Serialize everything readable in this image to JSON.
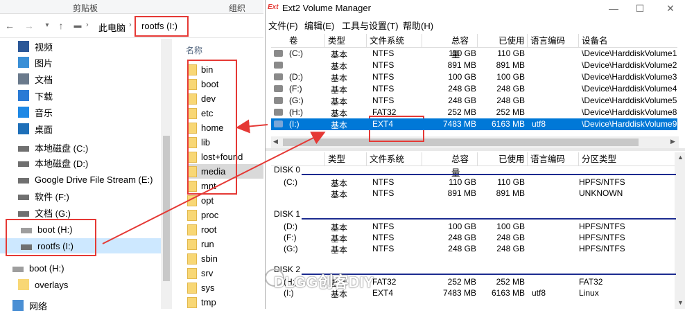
{
  "explorer": {
    "ribbon": [
      "剪贴板",
      "组织"
    ],
    "breadcrumb": [
      "此电脑",
      "rootfs (I:)"
    ],
    "nav_items": [
      {
        "label": "视频",
        "icon": "video-icon"
      },
      {
        "label": "图片",
        "icon": "picture-icon"
      },
      {
        "label": "文档",
        "icon": "document-icon"
      },
      {
        "label": "下载",
        "icon": "download-icon"
      },
      {
        "label": "音乐",
        "icon": "music-icon"
      },
      {
        "label": "桌面",
        "icon": "desktop-icon"
      },
      {
        "label": "本地磁盘 (C:)",
        "icon": "drive-icon"
      },
      {
        "label": "本地磁盘 (D:)",
        "icon": "drive-icon"
      },
      {
        "label": "Google Drive File Stream (E:)",
        "icon": "drive-icon"
      },
      {
        "label": "软件 (F:)",
        "icon": "drive-icon"
      },
      {
        "label": "文档 (G:)",
        "icon": "drive-icon"
      },
      {
        "label": "boot (H:)",
        "icon": "usb-drive-icon"
      },
      {
        "label": "rootfs (I:)",
        "icon": "drive-icon"
      },
      {
        "label": "boot (H:)",
        "icon": "usb-drive-icon"
      },
      {
        "label": "overlays",
        "icon": "folder-icon"
      },
      {
        "label": "网络",
        "icon": "network-icon"
      }
    ],
    "files_header": "名称",
    "files": [
      "bin",
      "boot",
      "dev",
      "etc",
      "home",
      "lib",
      "lost+found",
      "media",
      "mnt",
      "opt",
      "proc",
      "root",
      "run",
      "sbin",
      "srv",
      "sys",
      "tmp"
    ]
  },
  "ext2": {
    "title": "Ext2 Volume Manager",
    "app_icon_text": "Ext",
    "menus": [
      "文件(F)",
      "编辑(E)",
      "工具与设置(T)",
      "帮助(H)"
    ],
    "volume_headers": [
      "卷",
      "类型",
      "文件系统",
      "总容量",
      "已使用",
      "语言编码",
      "设备名"
    ],
    "volumes": [
      {
        "vol": "(C:)",
        "type": "基本",
        "fs": "NTFS",
        "total": "110 GB",
        "used": "110 GB",
        "enc": "",
        "device": "\\Device\\HarddiskVolume1"
      },
      {
        "vol": "",
        "type": "基本",
        "fs": "NTFS",
        "total": "891 MB",
        "used": "891 MB",
        "enc": "",
        "device": "\\Device\\HarddiskVolume2"
      },
      {
        "vol": "(D:)",
        "type": "基本",
        "fs": "NTFS",
        "total": "100 GB",
        "used": "100 GB",
        "enc": "",
        "device": "\\Device\\HarddiskVolume3"
      },
      {
        "vol": "(F:)",
        "type": "基本",
        "fs": "NTFS",
        "total": "248 GB",
        "used": "248 GB",
        "enc": "",
        "device": "\\Device\\HarddiskVolume4"
      },
      {
        "vol": "(G:)",
        "type": "基本",
        "fs": "NTFS",
        "total": "248 GB",
        "used": "248 GB",
        "enc": "",
        "device": "\\Device\\HarddiskVolume5"
      },
      {
        "vol": "(H:)",
        "type": "基本",
        "fs": "FAT32",
        "total": "252 MB",
        "used": "252 MB",
        "enc": "",
        "device": "\\Device\\HarddiskVolume8"
      },
      {
        "vol": "(I:)",
        "type": "基本",
        "fs": "EXT4",
        "total": "7483 MB",
        "used": "6163 MB",
        "enc": "utf8",
        "device": "\\Device\\HarddiskVolume9"
      }
    ],
    "disk_headers": [
      "类型",
      "文件系统",
      "总容量",
      "已使用",
      "语言编码",
      "分区类型"
    ],
    "disks": [
      {
        "name": "DISK 0",
        "parts": [
          {
            "vol": "(C:)",
            "type": "基本",
            "fs": "NTFS",
            "total": "110 GB",
            "used": "110 GB",
            "enc": "",
            "ptype": "HPFS/NTFS"
          },
          {
            "vol": "",
            "type": "基本",
            "fs": "NTFS",
            "total": "891 MB",
            "used": "891 MB",
            "enc": "",
            "ptype": "UNKNOWN"
          }
        ]
      },
      {
        "name": "DISK 1",
        "parts": [
          {
            "vol": "(D:)",
            "type": "基本",
            "fs": "NTFS",
            "total": "100 GB",
            "used": "100 GB",
            "enc": "",
            "ptype": "HPFS/NTFS"
          },
          {
            "vol": "(F:)",
            "type": "基本",
            "fs": "NTFS",
            "total": "248 GB",
            "used": "248 GB",
            "enc": "",
            "ptype": "HPFS/NTFS"
          },
          {
            "vol": "(G:)",
            "type": "基本",
            "fs": "NTFS",
            "total": "248 GB",
            "used": "248 GB",
            "enc": "",
            "ptype": "HPFS/NTFS"
          }
        ]
      },
      {
        "name": "DISK 2",
        "parts": [
          {
            "vol": "(H:)",
            "type": "基本",
            "fs": "FAT32",
            "total": "252 MB",
            "used": "252 MB",
            "enc": "",
            "ptype": "FAT32"
          },
          {
            "vol": "(I:)",
            "type": "基本",
            "fs": "EXT4",
            "total": "7483 MB",
            "used": "6163 MB",
            "enc": "utf8",
            "ptype": "Linux"
          }
        ]
      }
    ]
  },
  "watermark": "DLGG创客DIY",
  "colors": {
    "selection": "#0078d7",
    "highlight": "#e53935",
    "nav_selected": "#cde8ff"
  }
}
